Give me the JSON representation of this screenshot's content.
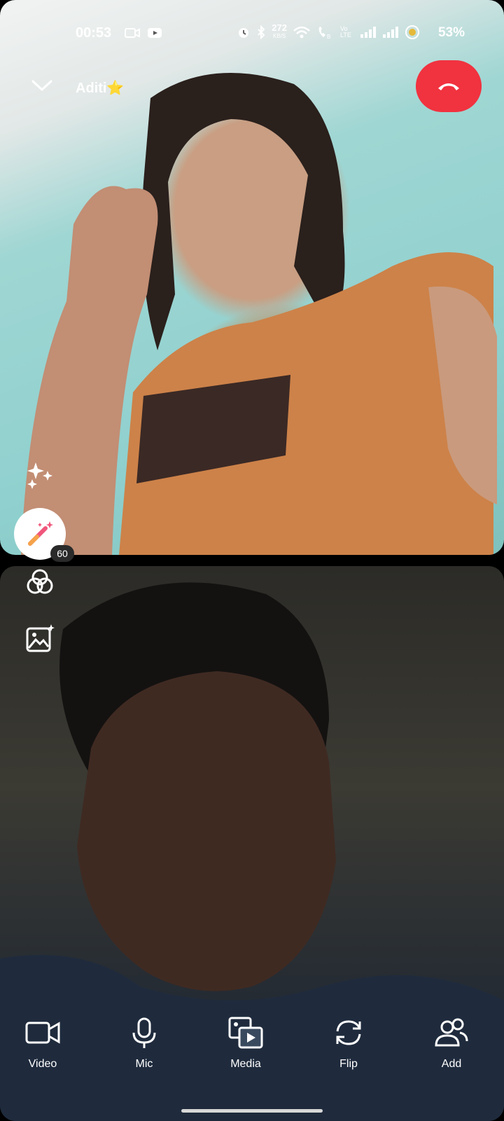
{
  "status_bar": {
    "time": "00:53",
    "data_speed": "272",
    "data_speed_unit": "KB/S",
    "volte": "Vo LTE",
    "battery": "53%"
  },
  "call": {
    "contact_name": "Aditi⭐",
    "end_call_color": "#f1323f"
  },
  "effects": {
    "badge_count": "60"
  },
  "toolbar": {
    "items": [
      {
        "label": "Video",
        "icon": "video-camera-icon"
      },
      {
        "label": "Mic",
        "icon": "microphone-icon"
      },
      {
        "label": "Media",
        "icon": "media-icon"
      },
      {
        "label": "Flip",
        "icon": "flip-camera-icon"
      },
      {
        "label": "Add",
        "icon": "add-people-icon"
      }
    ]
  }
}
